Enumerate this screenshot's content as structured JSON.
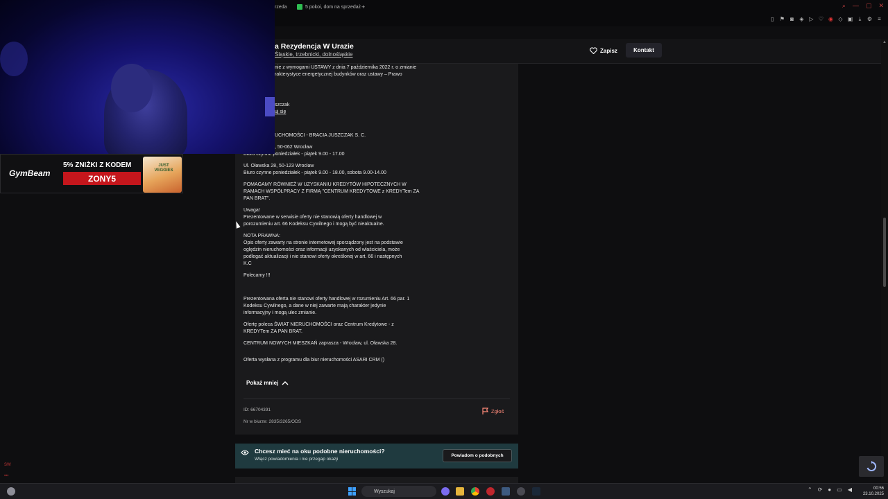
{
  "browser": {
    "tabs": [
      {
        "label": "rzeda"
      },
      {
        "label": "5 pokoi, dom na sprzedaż"
      }
    ],
    "new_tab_label": "+",
    "window_controls": [
      "—",
      "▢",
      "✕"
    ]
  },
  "header": {
    "title": "a Rezydencja W Urazie",
    "location": "Śląskie, trzebnicki, dolnośląskie",
    "save_label": "Zapisz",
    "contact_label": "Kontakt"
  },
  "description": {
    "lines": [
      "nie z wymogami USTAWY z dnia 7 października 2022 r. o zmianie",
      "rakterystyce energetycznej budynków oraz ustawy – Prawo",
      "szczak",
      "uj się",
      "UCHOMOŚCI - BRACIA JUSZCZAK S. C.",
      ", 50-062 Wrocław",
      "Biuro czynne poniedziałek - piątek 9.00 - 17.00",
      "Ul. Oławska 28, 50-123 Wrocław",
      "Biuro czynne poniedziałek - piątek 9.00 - 18.00, sobota 9.00-14.00",
      "POMAGAMY RÓWNIEŻ W UZYSKANIU KREDYTÓW HIPOTECZNYCH W",
      "RAMACH WSPÓŁPRACY Z FIRMĄ \"CENTRUM KREDYTOWE z KREDYTem ZA",
      "PAN BRAT\".",
      "Uwaga!",
      "Prezentowane w serwisie oferty nie stanowią oferty handlowej w",
      "porozumieniu art. 66 Kodeksu Cywilnego i mogą być nieaktualne.",
      "NOTA PRAWNA:",
      "Opis oferty zawarty na stronie internetowej sporządzony jest na podstawie",
      "oględzin nieruchomości oraz informacji uzyskanych od właściciela, może",
      "podlegać aktualizacji i nie stanowi oferty określonej w art. 66 i następnych",
      "K.C",
      "Polecamy !!!",
      "Prezentowana oferta nie stanowi oferty handlowej w rozumieniu Art. 66 par. 1",
      "Kodeksu Cywilnego, a dane w niej zawarte mają charakter jedynie",
      "informacyjny i mogą ulec zmianie.",
      "Ofertę poleca ŚWIAT NIERUCHOMOŚCI oraz Centrum Kredytowe - z",
      "KREDYTem ZA PAN BRAT.",
      "CENTRUM NOWYCH MIESZKAŃ zaprasza - Wrocław, ul. Oławska 28.",
      "Oferta wysłana z programu dla biur nieruchomości ASARI CRM ()"
    ],
    "show_less_label": "Pokaż mniej"
  },
  "meta": {
    "offer_id": "ID: 66704391",
    "office_number": "Nr w biurze: 2835/3265/ODS",
    "report_label": "Zgłoś"
  },
  "alerts": {
    "title": "Chcesz mieć na oku podobne nieruchomości?",
    "subtitle": "Włącz powiadomienia i nie przegap okazji",
    "button_label": "Powiadom o podobnych"
  },
  "sponsor": {
    "brand": "GymBeam",
    "headline": "5% ZNIŻKI Z KODEM",
    "code": "ZONY5",
    "product_label": "JUST VEGGIES"
  },
  "left_rail": {
    "item1": "SW",
    "item2": "•••"
  },
  "taskbar": {
    "search_placeholder": "Wyszukaj",
    "time": "00:56",
    "date": "23.10.2025",
    "accent_start": "#3ea1ff"
  },
  "colors": {
    "background": "#0e0e10",
    "card": "#1a1a1c",
    "alerts_bg": "#1f3a3f",
    "report_accent": "#ff8a7a",
    "sponsor_red": "#c4161c"
  }
}
